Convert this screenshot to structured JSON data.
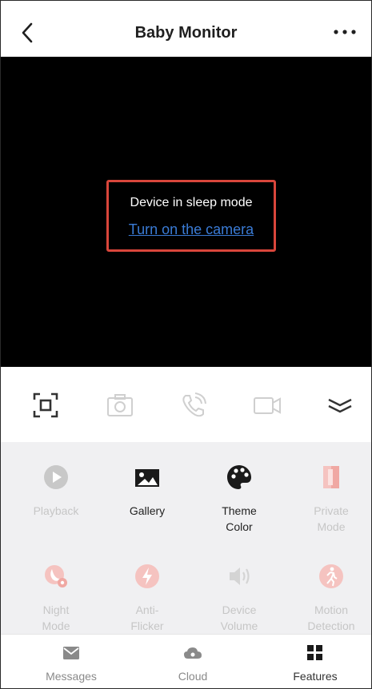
{
  "header": {
    "title": "Baby Monitor"
  },
  "video": {
    "status_text": "Device in sleep mode",
    "wake_link": "Turn on the camera"
  },
  "toolbar": {
    "icons": [
      "fullscreen-icon",
      "snapshot-icon",
      "talk-icon",
      "record-icon",
      "collapse-icon"
    ]
  },
  "features": {
    "items": [
      {
        "label": "Playback",
        "icon": "playback-icon",
        "enabled": false
      },
      {
        "label": "Gallery",
        "icon": "gallery-icon",
        "enabled": true
      },
      {
        "label": "Theme\nColor",
        "icon": "palette-icon",
        "enabled": true
      },
      {
        "label": "Private\nMode",
        "icon": "private-mode-icon",
        "enabled": false
      },
      {
        "label": "Night\nMode",
        "icon": "night-mode-icon",
        "enabled": false
      },
      {
        "label": "Anti-\nFlicker",
        "icon": "anti-flicker-icon",
        "enabled": false
      },
      {
        "label": "Device\nVolume",
        "icon": "volume-icon",
        "enabled": false
      },
      {
        "label": "Motion\nDetection",
        "icon": "motion-detection-icon",
        "enabled": false
      }
    ]
  },
  "bottom_nav": {
    "items": [
      {
        "label": "Messages",
        "icon": "messages-icon",
        "active": false
      },
      {
        "label": "Cloud",
        "icon": "cloud-icon",
        "active": false
      },
      {
        "label": "Features",
        "icon": "features-icon",
        "active": true
      }
    ]
  },
  "colors": {
    "accent_red": "#d9463b",
    "link_blue": "#3a7bd5",
    "disabled_pink": "#f5c3c0",
    "disabled_gray": "#c6c6c6"
  }
}
